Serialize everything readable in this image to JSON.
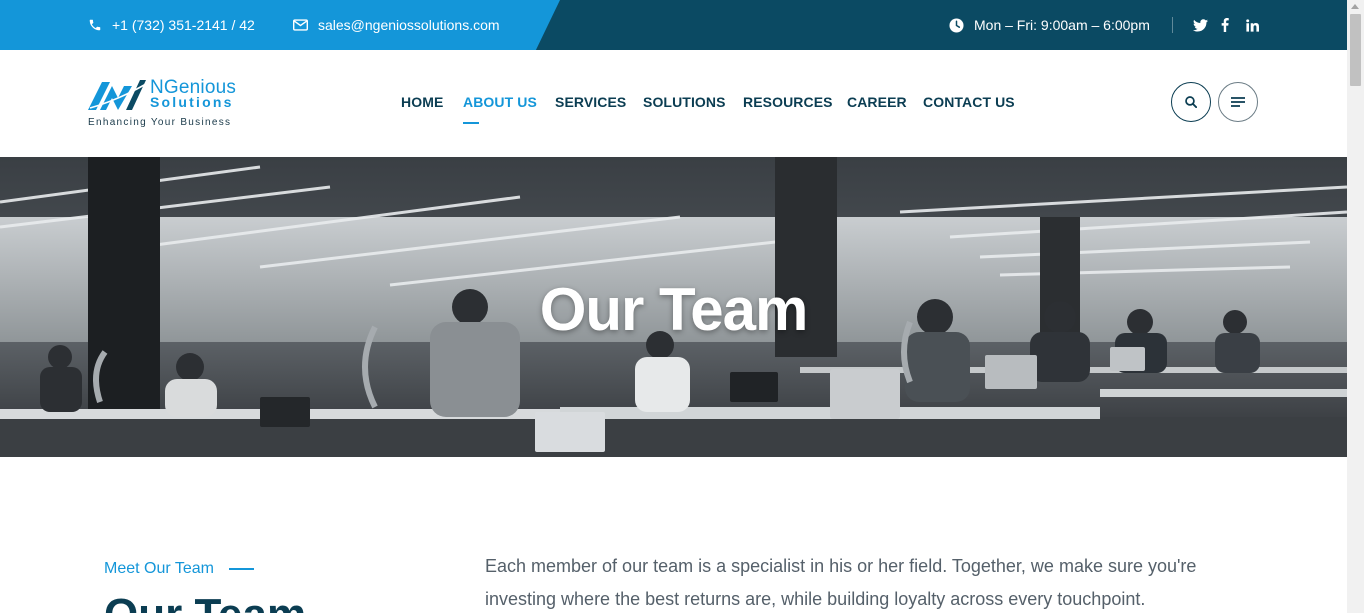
{
  "topbar": {
    "phone": "+1 (732) 351-2141 / 42",
    "email": "sales@ngeniossolutions.com",
    "hours": "Mon – Fri: 9:00am – 6:00pm",
    "social": [
      "twitter-icon",
      "facebook-icon",
      "linkedin-icon"
    ]
  },
  "logo": {
    "name": "NGenious",
    "sub": "Solutions",
    "tagline": "Enhancing Your Business"
  },
  "nav": {
    "items": [
      {
        "label": "HOME"
      },
      {
        "label": "ABOUT US",
        "active": true
      },
      {
        "label": "SERVICES"
      },
      {
        "label": "SOLUTIONS"
      },
      {
        "label": "RESOURCES"
      },
      {
        "label": "CAREER"
      },
      {
        "label": "CONTACT US"
      }
    ]
  },
  "hero": {
    "title": "Our Team"
  },
  "content": {
    "eyebrow": "Meet Our Team",
    "heading": "Our Team",
    "intro": "Each member of our team is a specialist in his or her field. Together, we make sure you're investing where the best returns are, while building loyalty across every touchpoint."
  },
  "colors": {
    "brand_blue": "#1496d9",
    "navy": "#0b4a63",
    "heading": "#0b3d52"
  }
}
